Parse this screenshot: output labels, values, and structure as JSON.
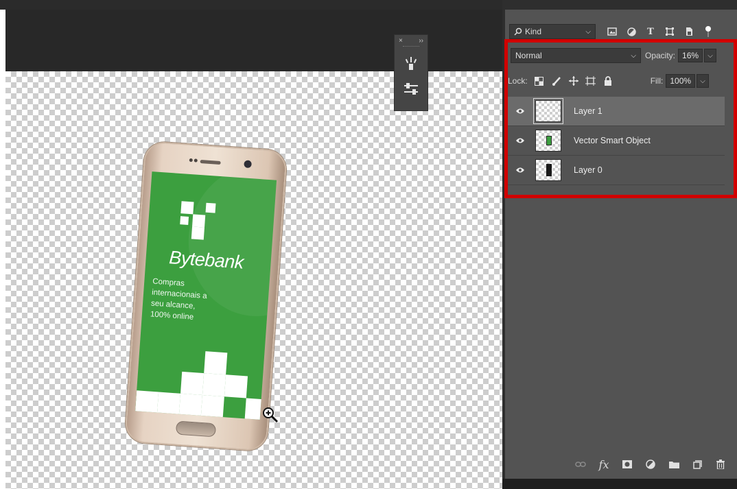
{
  "canvas": {
    "phone": {
      "brand_name": "Bytebank",
      "tagline_lines": [
        "Compras",
        "internacionais a",
        "seu alcance,",
        "100% online"
      ],
      "screen_color": "#3c9f3f"
    },
    "float_panel": {
      "close_glyph": "×",
      "expand_glyph": "››"
    },
    "cursor": "zoom-in-icon"
  },
  "layers_panel": {
    "filter": {
      "kind_label": "Kind",
      "icons": [
        "image-filter-icon",
        "adjustment-filter-icon",
        "type-filter-icon",
        "shape-filter-icon",
        "smart-object-filter-icon"
      ],
      "type_glyph": "T"
    },
    "blend_mode": "Normal",
    "opacity_label": "Opacity:",
    "opacity_value": "16%",
    "lock_label": "Lock:",
    "fill_label": "Fill:",
    "fill_value": "100%",
    "layers": [
      {
        "name": "Layer 1",
        "visible": true,
        "selected": true
      },
      {
        "name": "Vector Smart Object",
        "visible": true,
        "selected": false
      },
      {
        "name": "Layer 0",
        "visible": true,
        "selected": false
      }
    ],
    "footer": {
      "fx_label": "fx"
    },
    "highlight_color": "#d10000"
  }
}
